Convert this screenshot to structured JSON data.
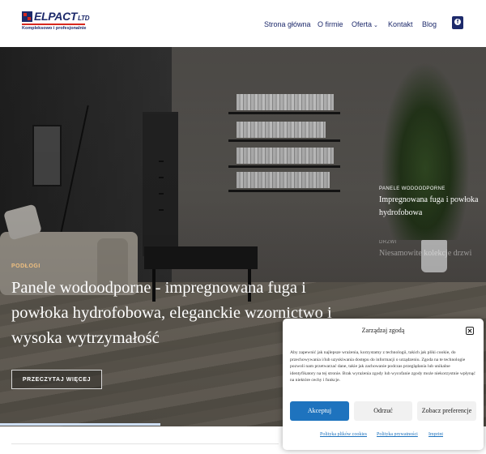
{
  "brand": {
    "name": "ELPACT",
    "suffix": "LTD",
    "tagline": "Kompleksowo i profesjonalnie"
  },
  "nav": {
    "items": [
      "Strona główna",
      "O firmie",
      "Oferta",
      "Kontakt",
      "Blog"
    ],
    "social_icon": "facebook-icon"
  },
  "hero": {
    "category": "PODŁOGI",
    "title": "Panele wodoodporne - impregnowana fuga i powłoka hydrofobowa, eleganckie wzornictwo i wysoka wytrzymałość",
    "button_label": "PRZECZYTAJ WIĘCEJ",
    "slides": [
      {
        "category": "PANELE WODOODPORNE",
        "title": "Impregnowana fuga i powłoka hydrofobowa",
        "active": true
      },
      {
        "category": "DRZWI",
        "title": "Niesamowite kolekcje drzwi",
        "active": false
      }
    ],
    "progress": 0.33
  },
  "consent": {
    "title": "Zarządzaj zgodą",
    "close_icon": "close-icon",
    "text": "Aby zapewnić jak najlepsze wrażenia, korzystamy z technologii, takich jak pliki cookie, do przechowywania i/lub uzyskiwania dostępu do informacji o urządzeniu. Zgoda na te technologie pozwoli nam przetwarzać dane, takie jak zachowanie podczas przeglądania lub unikalne identyfikatory na tej stronie. Brak wyrażenia zgody lub wycofanie zgody może niekorzystnie wpłynąć na niektóre cechy i funkcje.",
    "accept_label": "Akceptuj",
    "deny_label": "Odrzuć",
    "prefs_label": "Zobacz preferencje",
    "links": [
      "Polityka plików cookies",
      "Polityka prywatności",
      "Imprint"
    ]
  },
  "colors": {
    "brand_navy": "#1d2a6b",
    "brand_red": "#d6281e",
    "accent_blue": "#1e73be"
  }
}
